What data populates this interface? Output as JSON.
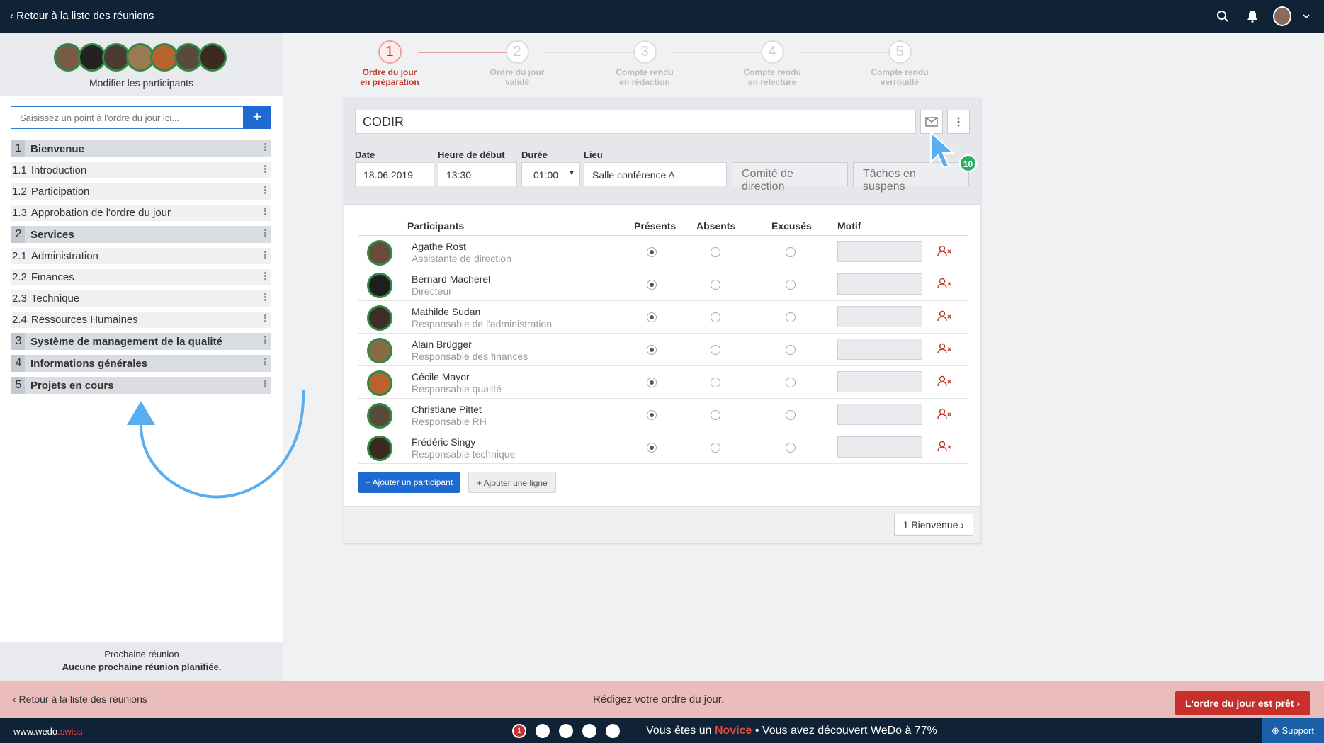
{
  "topbar": {
    "back_label": "‹ Retour à la liste des réunions"
  },
  "sidebar": {
    "modify_label": "Modifier les participants",
    "input_placeholder": "Saisissez un point à l'ordre du jour ici...",
    "add_label": "+",
    "items": [
      {
        "num": "1",
        "label": "Bienvenue",
        "main": true
      },
      {
        "num": "1.1",
        "label": "Introduction",
        "main": false
      },
      {
        "num": "1.2",
        "label": "Participation",
        "main": false
      },
      {
        "num": "1.3",
        "label": "Approbation de l'ordre du jour",
        "main": false
      },
      {
        "num": "2",
        "label": "Services",
        "main": true
      },
      {
        "num": "2.1",
        "label": "Administration",
        "main": false
      },
      {
        "num": "2.2",
        "label": "Finances",
        "main": false
      },
      {
        "num": "2.3",
        "label": "Technique",
        "main": false
      },
      {
        "num": "2.4",
        "label": "Ressources Humaines",
        "main": false
      },
      {
        "num": "3",
        "label": "Système de management de la qualité",
        "main": true
      },
      {
        "num": "4",
        "label": "Informations générales",
        "main": true
      },
      {
        "num": "5",
        "label": "Projets en cours",
        "main": true
      }
    ],
    "next_meeting_title": "Prochaine réunion",
    "next_meeting_value": "Aucune prochaine réunion planifiée."
  },
  "steps": [
    {
      "num": "1",
      "line1": "Ordre du jour",
      "line2": "en préparation",
      "active": true
    },
    {
      "num": "2",
      "line1": "Ordre du jour",
      "line2": "validé",
      "active": false
    },
    {
      "num": "3",
      "line1": "Compte rendu",
      "line2": "en rédaction",
      "active": false
    },
    {
      "num": "4",
      "line1": "Compte rendu",
      "line2": "en relecture",
      "active": false
    },
    {
      "num": "5",
      "line1": "Compte rendu",
      "line2": "verrouillé",
      "active": false
    }
  ],
  "meeting": {
    "title": "CODIR",
    "date_label": "Date",
    "date": "18.06.2019",
    "start_label": "Heure de début",
    "start": "13:30",
    "duration_label": "Durée",
    "duration": "01:00",
    "place_label": "Lieu",
    "place": "Salle conférence A",
    "committee_btn": "Comité de direction",
    "tasks_btn": "Tâches en suspens",
    "badge": "10"
  },
  "table": {
    "headers": {
      "participants": "Participants",
      "present": "Présents",
      "absent": "Absents",
      "excused": "Excusés",
      "reason": "Motif"
    },
    "rows": [
      {
        "name": "Agathe Rost",
        "role": "Assistante de direction",
        "status": "present"
      },
      {
        "name": "Bernard Macherel",
        "role": "Directeur",
        "status": "present"
      },
      {
        "name": "Mathilde Sudan",
        "role": "Responsable de l'administration",
        "status": "present"
      },
      {
        "name": "Alain Brügger",
        "role": "Responsable des finances",
        "status": "present"
      },
      {
        "name": "Cécile Mayor",
        "role": "Responsable qualité",
        "status": "present"
      },
      {
        "name": "Christiane Pittet",
        "role": "Responsable RH",
        "status": "present"
      },
      {
        "name": "Frédéric Singy",
        "role": "Responsable technique",
        "status": "present"
      }
    ],
    "add_participant": "+ Ajouter un participant",
    "add_line": "+ Ajouter une ligne"
  },
  "next_button": "1 Bienvenue ›",
  "status_bar": {
    "back_label": "‹  Retour à la liste des réunions",
    "message": "Rédigez votre ordre du jour.",
    "ready_button": "L'ordre du jour est prêt ›"
  },
  "bottom_bar": {
    "brand_a": "www.wedo",
    "brand_b": ".swiss",
    "progress_steps": [
      "1",
      "",
      "",
      "",
      ""
    ],
    "novice_a": "Vous êtes un ",
    "novice_level": "Novice",
    "novice_b": " • Vous avez découvert WeDo à 77%",
    "support": "⊕ Support"
  }
}
